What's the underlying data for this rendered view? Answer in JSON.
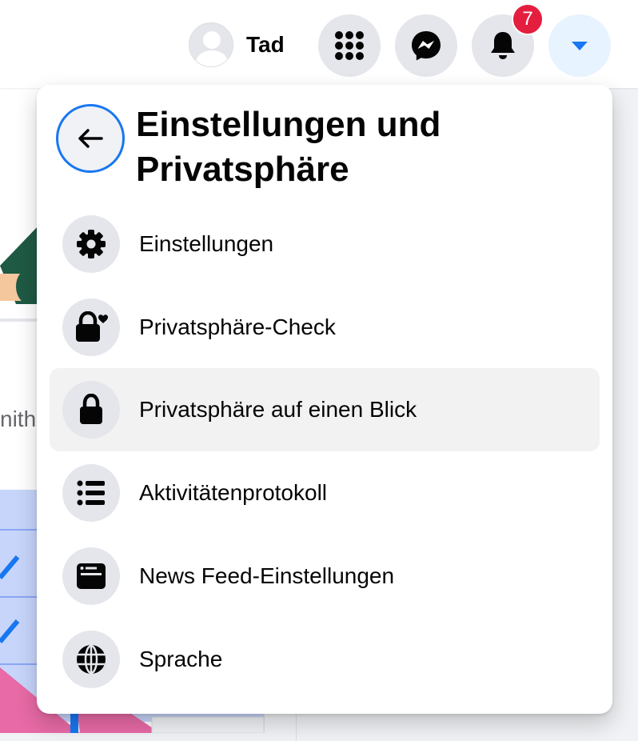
{
  "topbar": {
    "profile_name": "Tad",
    "notification_count": "7",
    "accent_color": "#1877f2",
    "badge_color": "#e41e3f"
  },
  "background": {
    "partial_text": "nith"
  },
  "panel": {
    "title": "Einstellungen und Privatsphäre",
    "back_icon": "arrow-left-icon",
    "items": [
      {
        "label": "Einstellungen",
        "icon": "gear-icon"
      },
      {
        "label": "Privatsphäre-Check",
        "icon": "lock-heart-icon"
      },
      {
        "label": "Privatsphäre auf einen Blick",
        "icon": "lock-icon"
      },
      {
        "label": "Aktivitätenprotokoll",
        "icon": "list-icon"
      },
      {
        "label": "News Feed-Einstellungen",
        "icon": "news-feed-icon"
      },
      {
        "label": "Sprache",
        "icon": "globe-icon"
      }
    ]
  }
}
